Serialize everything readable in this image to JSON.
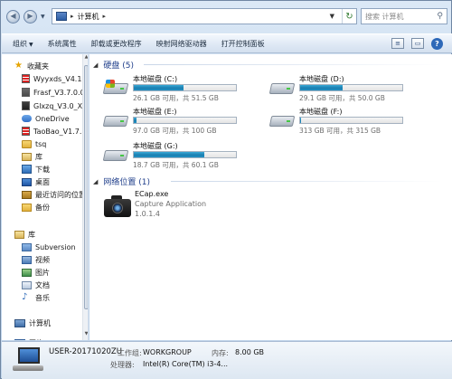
{
  "address": {
    "crumb": "计算机",
    "search_placeholder": "搜索 计算机"
  },
  "toolbar": {
    "organize": "组织",
    "system_properties": "系统属性",
    "uninstall": "卸载或更改程序",
    "map_drive": "映射网络驱动器",
    "control_panel": "打开控制面板"
  },
  "nav": {
    "favorites": "收藏夹",
    "fav_items": [
      "Wyyxds_V4.1.1.",
      "Frasf_V3.7.0.0_X",
      "Glxzq_V3.0_XiTo",
      "OneDrive",
      "TaoBao_V1.7.8.",
      "tsq",
      "库",
      "下载",
      "桌面",
      "最近访问的位置",
      "备份"
    ],
    "libraries": "库",
    "lib_items": [
      "Subversion",
      "视频",
      "图片",
      "文档",
      "音乐"
    ],
    "computer": "计算机",
    "network": "网络"
  },
  "main": {
    "disks_header": "硬盘 (5)",
    "drives": [
      {
        "name": "本地磁盘 (C:)",
        "info": "26.1 GB 可用，共 51.5 GB",
        "used_fraction": 0.49,
        "system": true
      },
      {
        "name": "本地磁盘 (D:)",
        "info": "29.1 GB 可用，共 50.0 GB",
        "used_fraction": 0.42,
        "system": false
      },
      {
        "name": "本地磁盘 (E:)",
        "info": "97.0 GB 可用，共 100 GB",
        "used_fraction": 0.03,
        "system": false
      },
      {
        "name": "本地磁盘 (F:)",
        "info": "313 GB 可用，共 315 GB",
        "used_fraction": 0.01,
        "system": false
      },
      {
        "name": "本地磁盘 (G:)",
        "info": "18.7 GB 可用，共 60.1 GB",
        "used_fraction": 0.69,
        "system": false
      }
    ],
    "network_header": "网络位置 (1)",
    "network_item": {
      "name": "ECap.exe",
      "desc": "Capture Application",
      "version": "1.0.1.4"
    }
  },
  "details": {
    "computer_name": "USER-20171020ZU",
    "workgroup_label": "工作组:",
    "workgroup": "WORKGROUP",
    "memory_label": "内存:",
    "memory": "8.00 GB",
    "cpu_label": "处理器:",
    "cpu": "Intel(R) Core(TM) i3-4..."
  }
}
